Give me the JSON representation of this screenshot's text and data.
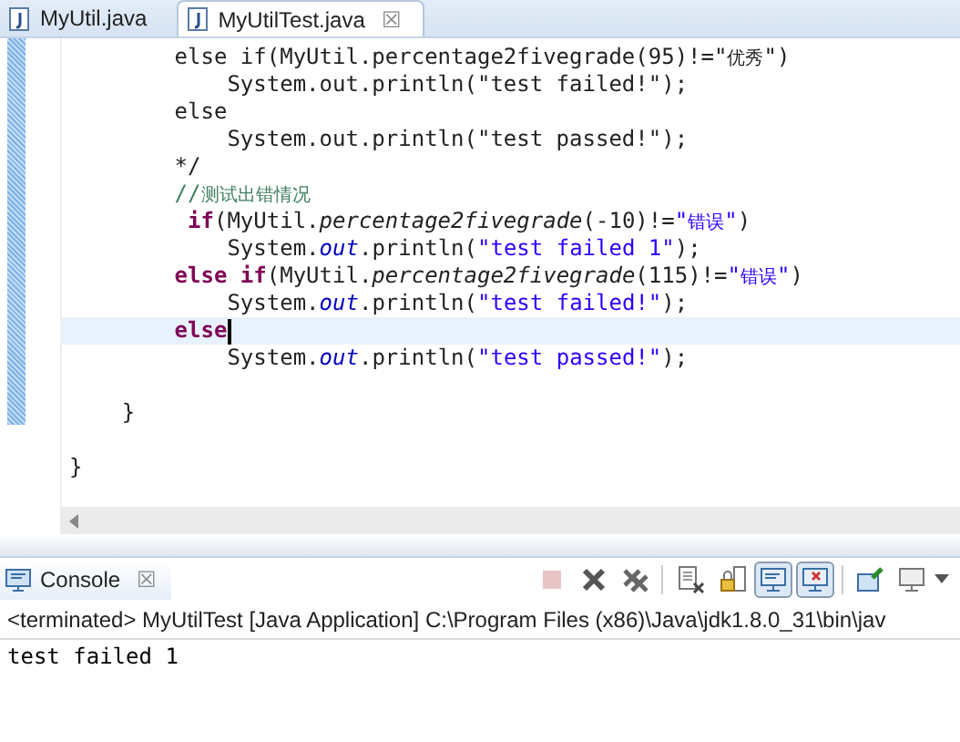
{
  "editor_tabs": [
    {
      "label": "MyUtil.java",
      "selected": false,
      "closable": false
    },
    {
      "label": "MyUtilTest.java",
      "selected": true,
      "closable": true
    }
  ],
  "close_glyph": "☒",
  "code_lines": [
    {
      "current": false,
      "tokens": [
        {
          "text": "        else if(MyUtil.percentage2fivegrade(95)!=\"",
          "kind": "plain"
        },
        {
          "text": "优秀",
          "kind": "cjk"
        },
        {
          "text": "\")",
          "kind": "plain"
        }
      ]
    },
    {
      "current": false,
      "tokens": [
        {
          "text": "            System.out.println(\"test failed!\");",
          "kind": "plain"
        }
      ]
    },
    {
      "current": false,
      "tokens": [
        {
          "text": "        else",
          "kind": "plain"
        }
      ]
    },
    {
      "current": false,
      "tokens": [
        {
          "text": "            System.out.println(\"test passed!\");",
          "kind": "plain"
        }
      ]
    },
    {
      "current": false,
      "tokens": [
        {
          "text": "        */",
          "kind": "plain"
        }
      ]
    },
    {
      "current": false,
      "tokens": [
        {
          "text": "        //",
          "kind": "comment"
        },
        {
          "text": "测试出错情况",
          "kind": "cjk-comment"
        }
      ]
    },
    {
      "current": false,
      "tokens": [
        {
          "text": "         if",
          "kind": "keyword"
        },
        {
          "text": "(MyUtil.",
          "kind": "plain"
        },
        {
          "text": "percentage2fivegrade",
          "kind": "italic"
        },
        {
          "text": "(-10)!=",
          "kind": "plain"
        },
        {
          "text": "\"",
          "kind": "string"
        },
        {
          "text": "错误",
          "kind": "cjk-string"
        },
        {
          "text": "\"",
          "kind": "string"
        },
        {
          "text": ")",
          "kind": "plain"
        }
      ]
    },
    {
      "current": false,
      "tokens": [
        {
          "text": "            System.",
          "kind": "plain"
        },
        {
          "text": "out",
          "kind": "field"
        },
        {
          "text": ".println(",
          "kind": "plain"
        },
        {
          "text": "\"test failed 1\"",
          "kind": "string"
        },
        {
          "text": ");",
          "kind": "plain"
        }
      ]
    },
    {
      "current": false,
      "tokens": [
        {
          "text": "        else if",
          "kind": "keyword"
        },
        {
          "text": "(MyUtil.",
          "kind": "plain"
        },
        {
          "text": "percentage2fivegrade",
          "kind": "italic"
        },
        {
          "text": "(115)!=",
          "kind": "plain"
        },
        {
          "text": "\"",
          "kind": "string"
        },
        {
          "text": "错误",
          "kind": "cjk-string"
        },
        {
          "text": "\"",
          "kind": "string"
        },
        {
          "text": ")",
          "kind": "plain"
        }
      ]
    },
    {
      "current": false,
      "tokens": [
        {
          "text": "            System.",
          "kind": "plain"
        },
        {
          "text": "out",
          "kind": "field"
        },
        {
          "text": ".println(",
          "kind": "plain"
        },
        {
          "text": "\"test failed!\"",
          "kind": "string"
        },
        {
          "text": ");",
          "kind": "plain"
        }
      ]
    },
    {
      "current": true,
      "tokens": [
        {
          "text": "        else",
          "kind": "keyword"
        }
      ]
    },
    {
      "current": false,
      "tokens": [
        {
          "text": "            System.",
          "kind": "plain"
        },
        {
          "text": "out",
          "kind": "field"
        },
        {
          "text": ".println(",
          "kind": "plain"
        },
        {
          "text": "\"test passed!\"",
          "kind": "string"
        },
        {
          "text": ");",
          "kind": "plain"
        }
      ]
    },
    {
      "current": false
    },
    {
      "current": false,
      "tokens": [
        {
          "text": "    }",
          "kind": "plain"
        }
      ]
    },
    {
      "current": false
    },
    {
      "current": false,
      "tokens": [
        {
          "text": "}",
          "kind": "plain"
        }
      ]
    }
  ],
  "console": {
    "tab": {
      "label": "Console",
      "selected": true
    },
    "toolbar": [
      {
        "kind": "stop",
        "pressed": false,
        "disabled": true
      },
      {
        "kind": "remove",
        "pressed": false,
        "disabled": false
      },
      {
        "kind": "remove-all",
        "pressed": false,
        "disabled": false
      },
      {
        "kind": "clear",
        "pressed": false,
        "disabled": false
      },
      {
        "kind": "scroll-lock",
        "pressed": false,
        "disabled": false
      },
      {
        "kind": "show-out",
        "pressed": true,
        "disabled": false
      },
      {
        "kind": "show-err",
        "pressed": true,
        "disabled": false
      },
      {
        "kind": "pin",
        "pressed": false,
        "disabled": false
      },
      {
        "kind": "display",
        "pressed": false,
        "disabled": false
      }
    ],
    "process": "<terminated> MyUtilTest [Java Application] C:\\Program Files (x86)\\Java\\jdk1.8.0_31\\bin\\jav",
    "output": [
      "test failed 1"
    ]
  }
}
